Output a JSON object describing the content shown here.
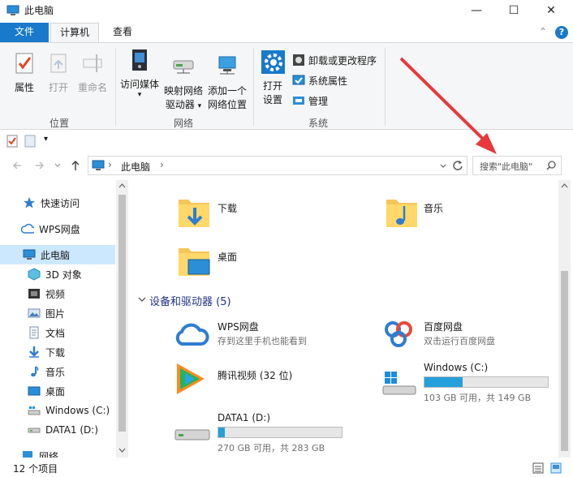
{
  "window": {
    "title": "此电脑",
    "minimize_glyph": "—",
    "maximize_glyph": "☐",
    "close_glyph": "✕"
  },
  "ribbon_tabs": {
    "file": "文件",
    "computer": "计算机",
    "view": "查看"
  },
  "ribbon": {
    "help_glyph": "?",
    "collapse_glyph": "⌃",
    "groups": {
      "location": "位置",
      "network": "网络",
      "system": "系统"
    },
    "location": {
      "properties": "属性",
      "open": "打开",
      "rename": "重命名"
    },
    "network": {
      "access_media": "访问媒体",
      "map_drive_1": "映射网络",
      "map_drive_2": "驱动器",
      "add_location_1": "添加一个",
      "add_location_2": "网络位置"
    },
    "system": {
      "open_settings_1": "打开",
      "open_settings_2": "设置",
      "uninstall": "卸载或更改程序",
      "system_props": "系统属性",
      "manage": "管理"
    },
    "dropdown_glyph": "▾"
  },
  "address": {
    "path_root": "此电脑",
    "separator": "›",
    "search_placeholder": "搜索\"此电脑\""
  },
  "sidebar": {
    "items": [
      {
        "label": "快速访问"
      },
      {
        "label": "WPS网盘"
      },
      {
        "label": "此电脑"
      },
      {
        "label": "3D 对象"
      },
      {
        "label": "视频"
      },
      {
        "label": "图片"
      },
      {
        "label": "文档"
      },
      {
        "label": "下载"
      },
      {
        "label": "音乐"
      },
      {
        "label": "桌面"
      },
      {
        "label": "Windows (C:)"
      },
      {
        "label": "DATA1 (D:)"
      },
      {
        "label": "网络"
      }
    ]
  },
  "main": {
    "folders": [
      {
        "label": "下载"
      },
      {
        "label": "音乐"
      },
      {
        "label": "桌面"
      }
    ],
    "devices_header": "设备和驱动器 (5)",
    "devices": {
      "wps": {
        "name": "WPS网盘",
        "desc": "存到这里手机也能看到"
      },
      "baidu": {
        "name": "百度网盘",
        "desc": "双击运行百度网盘"
      },
      "tencent": {
        "name": "腾讯视频 (32 位)"
      },
      "c_drive": {
        "name": "Windows (C:)",
        "space": "103 GB 可用，共 149 GB",
        "used_fraction": 0.31
      },
      "d_drive": {
        "name": "DATA1 (D:)",
        "space": "270 GB 可用，共 283 GB",
        "used_fraction": 0.05
      }
    }
  },
  "status": {
    "count": "12 个项目"
  },
  "colors": {
    "accent": "#1979ca",
    "selected": "#cce8ff",
    "drive_fill": "#26a0da",
    "arrow": "#e8383b"
  }
}
